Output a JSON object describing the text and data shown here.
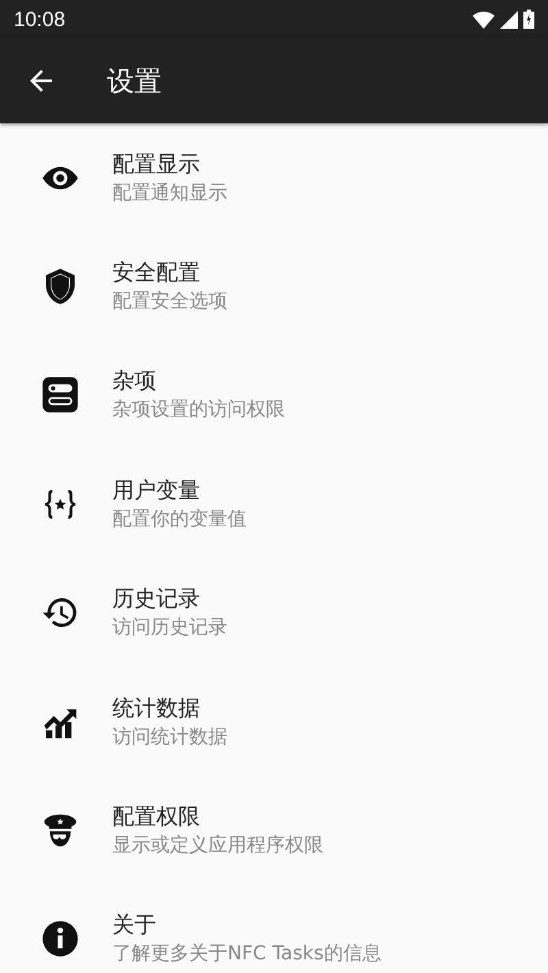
{
  "status_bar": {
    "time": "10:08"
  },
  "app_bar": {
    "title": "设置"
  },
  "items": [
    {
      "kind": "eye",
      "title": "配置显示",
      "subtitle": "配置通知显示"
    },
    {
      "kind": "shield",
      "title": "安全配置",
      "subtitle": "配置安全选项"
    },
    {
      "kind": "toggles",
      "title": "杂项",
      "subtitle": "杂项设置的访问权限"
    },
    {
      "kind": "variable",
      "title": "用户变量",
      "subtitle": "配置你的变量值"
    },
    {
      "kind": "history",
      "title": "历史记录",
      "subtitle": "访问历史记录"
    },
    {
      "kind": "chart",
      "title": "统计数据",
      "subtitle": "访问统计数据"
    },
    {
      "kind": "police",
      "title": "配置权限",
      "subtitle": "显示或定义应用程序权限"
    },
    {
      "kind": "info",
      "title": "关于",
      "subtitle": "了解更多关于NFC Tasks的信息"
    }
  ]
}
